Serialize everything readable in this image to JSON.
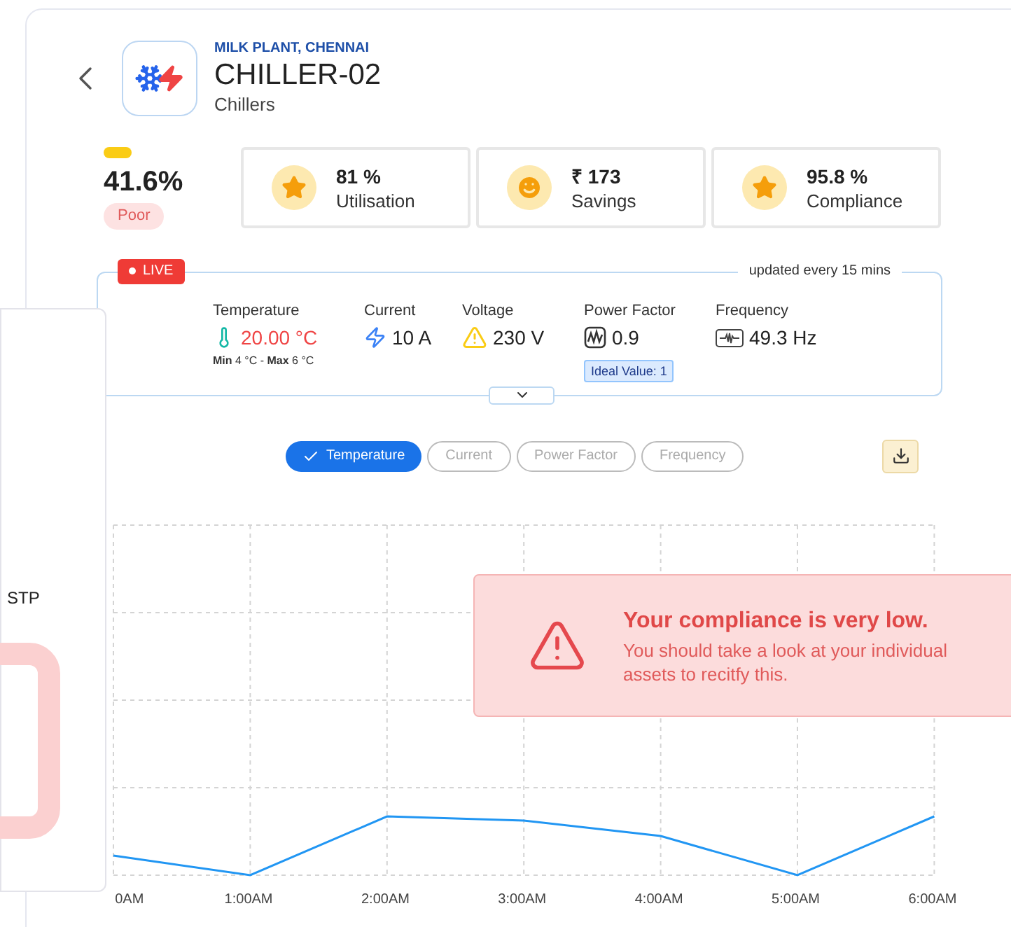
{
  "asset": {
    "location": "MILK PLANT, CHENNAI",
    "name": "CHILLER-02",
    "category": "Chillers"
  },
  "score": {
    "value": "41.6%",
    "rating": "Poor"
  },
  "stats": [
    {
      "kind": "star",
      "value": "81 %",
      "label": "Utilisation"
    },
    {
      "kind": "smile",
      "value": "₹ 173",
      "label": "Savings"
    },
    {
      "kind": "star",
      "value": "95.8 %",
      "label": "Compliance"
    }
  ],
  "live": {
    "badge": "LIVE",
    "note": "updated every 15 mins",
    "metrics": [
      {
        "kind": "temperature",
        "label": "Temperature",
        "value": "20.00 °C",
        "alert": true,
        "range": "**Min** 4 °C - **Max** 6 °C"
      },
      {
        "kind": "current",
        "label": "Current",
        "value": "10 A",
        "alert": false
      },
      {
        "kind": "voltage",
        "label": "Voltage",
        "value": "230 V",
        "alert": false
      },
      {
        "kind": "power",
        "label": "Power Factor",
        "value": "0.9",
        "alert": false,
        "ideal": "Ideal Value: 1"
      },
      {
        "kind": "frequency",
        "label": "Frequency",
        "value": "49.3 Hz",
        "alert": false
      }
    ]
  },
  "chart_tabs": [
    {
      "label": "Temperature",
      "selected": true
    },
    {
      "label": "Current",
      "selected": false
    },
    {
      "label": "Power Factor",
      "selected": false
    },
    {
      "label": "Frequency",
      "selected": false
    }
  ],
  "chart": {
    "x_labels": [
      "0AM",
      "1:00AM",
      "2:00AM",
      "3:00AM",
      "4:00AM",
      "5:00AM",
      "6:00AM"
    ]
  },
  "alert": {
    "title": "Your compliance is very low.",
    "message": "You should take a look at your individual assets to recitfy this."
  },
  "side_panel": {
    "label": "STP"
  }
}
